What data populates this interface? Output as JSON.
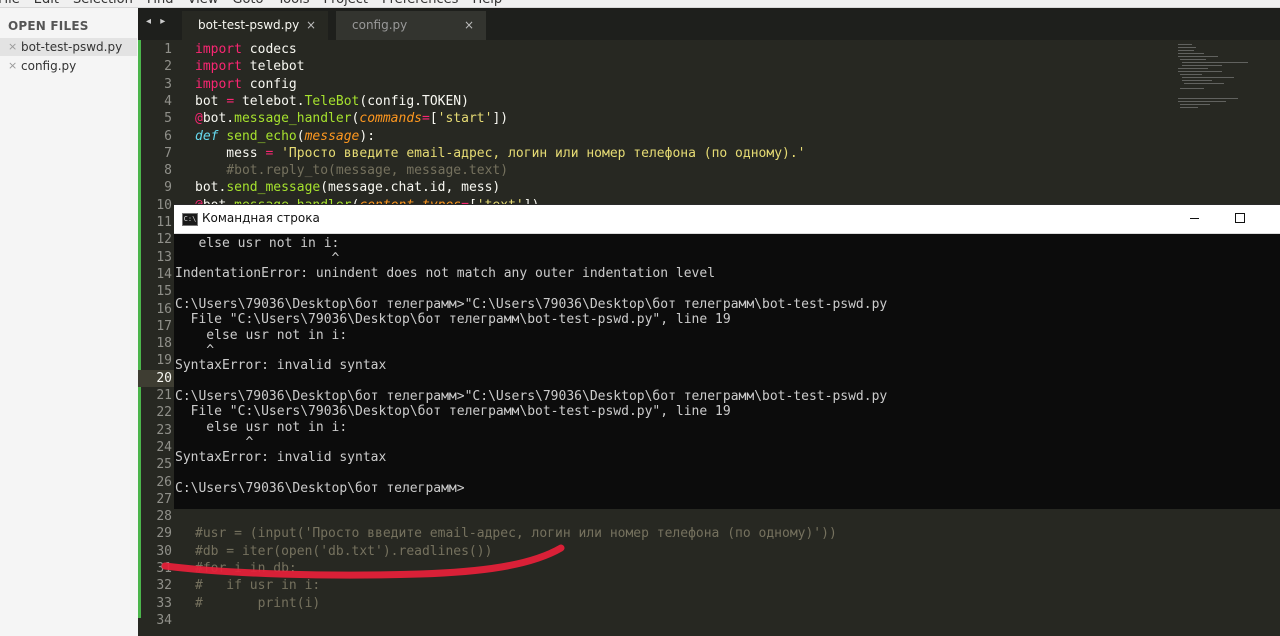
{
  "menubar": {
    "items": [
      "File",
      "Edit",
      "Selection",
      "Find",
      "View",
      "Goto",
      "Tools",
      "Project",
      "Preferences",
      "Help"
    ]
  },
  "sidebar": {
    "header": "OPEN FILES",
    "files": [
      {
        "close": "×",
        "label": "bot-test-pswd.py",
        "active": true
      },
      {
        "close": "×",
        "label": "config.py",
        "active": false
      }
    ]
  },
  "tabs": {
    "nav": "◂ ▸",
    "items": [
      {
        "label": "bot-test-pswd.py",
        "close": "×",
        "active": true
      },
      {
        "label": "config.py",
        "close": "×",
        "active": false
      }
    ]
  },
  "editor": {
    "current_line": 20,
    "line_numbers": [
      "1",
      "2",
      "3",
      "4",
      "5",
      "6",
      "7",
      "8",
      "9",
      "10",
      "11",
      "12",
      "13",
      "14",
      "15",
      "16",
      "17",
      "18",
      "19",
      "20",
      "21",
      "22",
      "23",
      "24",
      "25",
      "26",
      "27",
      "28",
      "29",
      "30",
      "31",
      "32",
      "33",
      "34"
    ],
    "visible_code": [
      {
        "line": 1,
        "tokens": [
          {
            "t": "import",
            "c": "kw"
          },
          {
            "t": " codecs",
            "c": ""
          }
        ]
      },
      {
        "line": 2,
        "tokens": [
          {
            "t": "import",
            "c": "kw"
          },
          {
            "t": " telebot",
            "c": ""
          }
        ]
      },
      {
        "line": 3,
        "tokens": [
          {
            "t": "import",
            "c": "kw"
          },
          {
            "t": " config",
            "c": ""
          }
        ]
      },
      {
        "line": 4,
        "tokens": [
          {
            "t": "bot ",
            "c": ""
          },
          {
            "t": "=",
            "c": "kw"
          },
          {
            "t": " telebot.",
            "c": ""
          },
          {
            "t": "TeleBot",
            "c": "fn"
          },
          {
            "t": "(config.TOKEN)",
            "c": ""
          }
        ]
      },
      {
        "line": 5,
        "tokens": [
          {
            "t": "@",
            "c": "kw"
          },
          {
            "t": "bot.",
            "c": ""
          },
          {
            "t": "message_handler",
            "c": "fn"
          },
          {
            "t": "(",
            "c": ""
          },
          {
            "t": "commands",
            "c": "param"
          },
          {
            "t": "=",
            "c": "kw"
          },
          {
            "t": "[",
            "c": ""
          },
          {
            "t": "'start'",
            "c": "str"
          },
          {
            "t": "])",
            "c": ""
          }
        ]
      },
      {
        "line": 6,
        "tokens": [
          {
            "t": "def",
            "c": "dk"
          },
          {
            "t": " ",
            "c": ""
          },
          {
            "t": "send_echo",
            "c": "fn"
          },
          {
            "t": "(",
            "c": ""
          },
          {
            "t": "message",
            "c": "param"
          },
          {
            "t": "):",
            "c": ""
          }
        ]
      },
      {
        "line": 7,
        "tokens": [
          {
            "t": "    mess ",
            "c": ""
          },
          {
            "t": "=",
            "c": "kw"
          },
          {
            "t": " ",
            "c": ""
          },
          {
            "t": "'Просто введите email-адрес, логин или номер телефона (по одному).'",
            "c": "str"
          }
        ]
      },
      {
        "line": 8,
        "tokens": [
          {
            "t": "    #bot.reply_to(message, message.text)",
            "c": "cm"
          }
        ]
      },
      {
        "line": 9,
        "tokens": [
          {
            "t": "bot.",
            "c": ""
          },
          {
            "t": "send_message",
            "c": "fn"
          },
          {
            "t": "(message.chat.id, mess)",
            "c": ""
          }
        ]
      },
      {
        "line": 10,
        "tokens": [
          {
            "t": "@",
            "c": "kw"
          },
          {
            "t": "bot.",
            "c": ""
          },
          {
            "t": "message_handler",
            "c": "fn"
          },
          {
            "t": "(",
            "c": ""
          },
          {
            "t": "content_types",
            "c": "param"
          },
          {
            "t": "=",
            "c": "kw"
          },
          {
            "t": "[",
            "c": ""
          },
          {
            "t": "'text'",
            "c": "str"
          },
          {
            "t": "])",
            "c": ""
          }
        ]
      },
      {
        "line": 29,
        "tokens": [
          {
            "t": "#usr = (input('Просто введите email-адрес, логин или номер телефона (по одному)'))",
            "c": "cm"
          }
        ]
      },
      {
        "line": 30,
        "tokens": [
          {
            "t": "#db = iter(open('db.txt').readlines())",
            "c": "cm"
          }
        ]
      },
      {
        "line": 31,
        "tokens": [
          {
            "t": "#for i in db:",
            "c": "cm"
          }
        ]
      },
      {
        "line": 32,
        "tokens": [
          {
            "t": "#   if usr in i:",
            "c": "cm"
          }
        ]
      },
      {
        "line": 33,
        "tokens": [
          {
            "t": "#       print(i)",
            "c": "cm"
          }
        ]
      }
    ]
  },
  "cmd": {
    "icon": "C:\\",
    "title": "Командная строка",
    "lines": [
      "   else usr not in i:",
      "                    ^",
      "IndentationError: unindent does not match any outer indentation level",
      "",
      "C:\\Users\\79036\\Desktop\\бот телеграмм>\"C:\\Users\\79036\\Desktop\\бот телеграмм\\bot-test-pswd.py",
      "  File \"C:\\Users\\79036\\Desktop\\бот телеграмм\\bot-test-pswd.py\", line 19",
      "    else usr not in i:",
      "    ^",
      "SyntaxError: invalid syntax",
      "",
      "C:\\Users\\79036\\Desktop\\бот телеграмм>\"C:\\Users\\79036\\Desktop\\бот телеграмм\\bot-test-pswd.py",
      "  File \"C:\\Users\\79036\\Desktop\\бот телеграмм\\bot-test-pswd.py\", line 19",
      "    else usr not in i:",
      "         ^",
      "SyntaxError: invalid syntax",
      "",
      "C:\\Users\\79036\\Desktop\\бот телеграмм>"
    ]
  },
  "colors": {
    "editor_bg": "#272822",
    "keyword": "#f92672",
    "function": "#a6e22e",
    "string": "#e6db74",
    "comment": "#75715e",
    "annotation_stroke": "#e8203a"
  }
}
